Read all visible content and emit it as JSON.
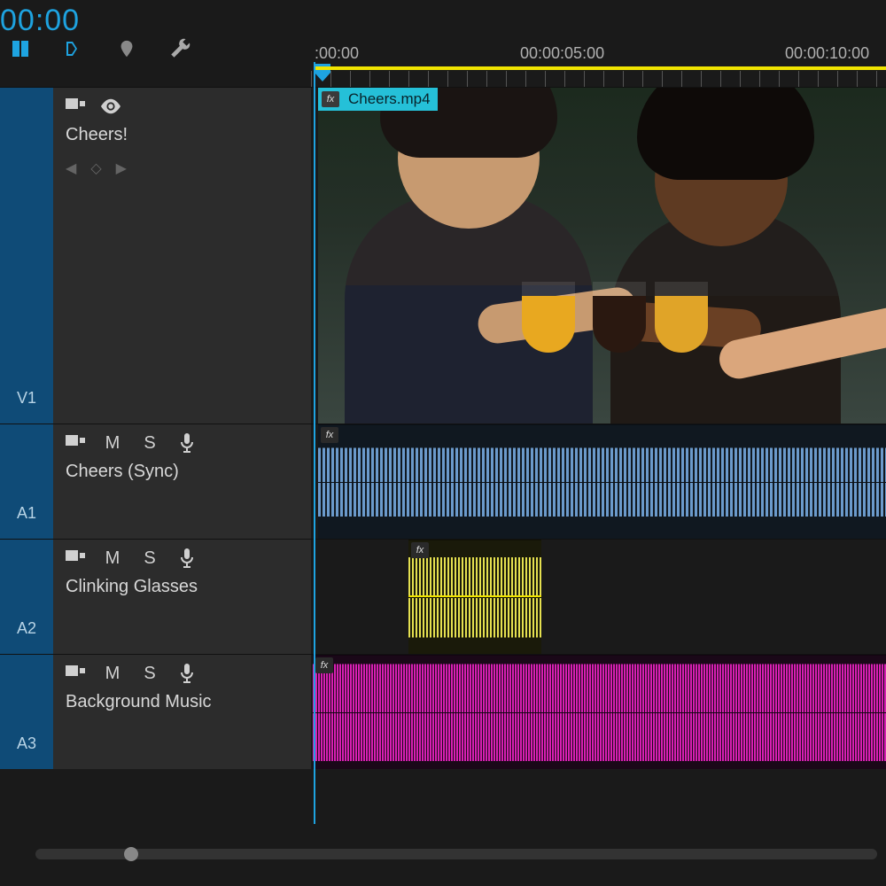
{
  "timecode": "00:00",
  "ruler": {
    "labels": [
      ":00:00",
      "00:00:05:00",
      "00:00:10:00"
    ]
  },
  "video_track": {
    "id": "V1",
    "name": "Cheers!",
    "clip_title": "Cheers.mp4"
  },
  "audio_tracks": [
    {
      "id": "A1",
      "name": "Cheers (Sync)",
      "mute": "M",
      "solo": "S",
      "color": "blue"
    },
    {
      "id": "A2",
      "name": "Clinking Glasses",
      "mute": "M",
      "solo": "S",
      "color": "yellow"
    },
    {
      "id": "A3",
      "name": "Background Music",
      "mute": "M",
      "solo": "S",
      "color": "magenta"
    }
  ],
  "fx_badge": "fx"
}
